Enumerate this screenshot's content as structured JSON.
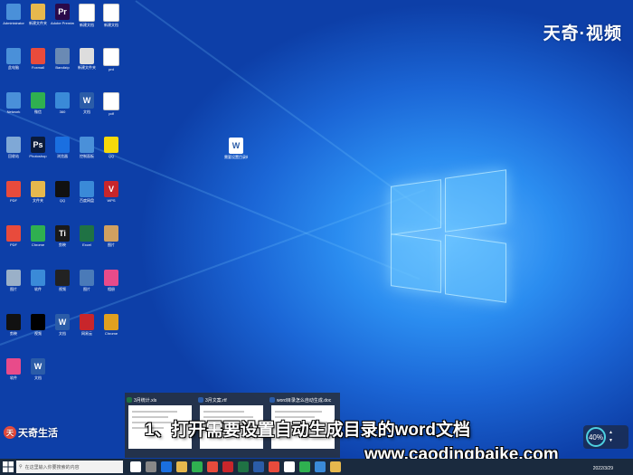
{
  "watermark": {
    "brand_top": "天奇·视频",
    "brand_bottom": "天奇生活"
  },
  "desktop_icons": [
    {
      "label": "Administrator",
      "color": "#4a90d9",
      "glyph": ""
    },
    {
      "label": "新建文件夹",
      "color": "#e6b84d",
      "glyph": ""
    },
    {
      "label": "Adobe Premiere",
      "color": "#2a0a4a",
      "glyph": "Pr"
    },
    {
      "label": "新建文档",
      "color": "#ffffff",
      "glyph": ""
    },
    {
      "label": "新建文档",
      "color": "#ffffff",
      "glyph": ""
    },
    {
      "label": "此电脑",
      "color": "#4a90d9",
      "glyph": ""
    },
    {
      "label": "Foxmail",
      "color": "#e84b3c",
      "glyph": ""
    },
    {
      "label": "Bandizip",
      "color": "#6a8ab4",
      "glyph": ""
    },
    {
      "label": "新建文件夹",
      "color": "#dddddd",
      "glyph": ""
    },
    {
      "label": "prd",
      "color": "#ffffff",
      "glyph": ""
    },
    {
      "label": "Network",
      "color": "#4a90d9",
      "glyph": ""
    },
    {
      "label": "微信",
      "color": "#2fb050",
      "glyph": ""
    },
    {
      "label": "360",
      "color": "#3a8ad8",
      "glyph": ""
    },
    {
      "label": "文档",
      "color": "#2b5ca8",
      "glyph": "W"
    },
    {
      "label": "pdf",
      "color": "#ffffff",
      "glyph": ""
    },
    {
      "label": "回收站",
      "color": "#7fa8d6",
      "glyph": ""
    },
    {
      "label": "Photoshop",
      "color": "#0a1a3a",
      "glyph": "Ps"
    },
    {
      "label": "浏览器",
      "color": "#1a6fe0",
      "glyph": ""
    },
    {
      "label": "控制面板",
      "color": "#4a90d9",
      "glyph": ""
    },
    {
      "label": "QQ",
      "color": "#f5d90a",
      "glyph": ""
    },
    {
      "label": "PDF",
      "color": "#e84b3c",
      "glyph": ""
    },
    {
      "label": "文件夹",
      "color": "#e6b84d",
      "glyph": ""
    },
    {
      "label": "QQ",
      "color": "#111111",
      "glyph": ""
    },
    {
      "label": "百度网盘",
      "color": "#3a8ad8",
      "glyph": ""
    },
    {
      "label": "WPS",
      "color": "#c8262b",
      "glyph": "V"
    },
    {
      "label": "PDF",
      "color": "#e84b3c",
      "glyph": ""
    },
    {
      "label": "Chrome",
      "color": "#2fb050",
      "glyph": ""
    },
    {
      "label": "剪映",
      "color": "#1a1a1a",
      "glyph": "Ti"
    },
    {
      "label": "Excel",
      "color": "#1f7244",
      "glyph": ""
    },
    {
      "label": "图片",
      "color": "#d0a060",
      "glyph": ""
    },
    {
      "label": "图片",
      "color": "#9ab0c8",
      "glyph": ""
    },
    {
      "label": "软件",
      "color": "#3a8ad8",
      "glyph": ""
    },
    {
      "label": "视频",
      "color": "#222222",
      "glyph": ""
    },
    {
      "label": "图片",
      "color": "#4a7ab8",
      "glyph": ""
    },
    {
      "label": "相册",
      "color": "#e84b8a",
      "glyph": ""
    },
    {
      "label": "剪映",
      "color": "#111111",
      "glyph": ""
    },
    {
      "label": "视频",
      "color": "#000000",
      "glyph": ""
    },
    {
      "label": "文档",
      "color": "#2b5ca8",
      "glyph": "W"
    },
    {
      "label": "网易云",
      "color": "#c8262b",
      "glyph": ""
    },
    {
      "label": "Chrome",
      "color": "#e0a020",
      "glyph": ""
    },
    {
      "label": "软件",
      "color": "#e84b8a",
      "glyph": ""
    },
    {
      "label": "文档",
      "color": "#2b5ca8",
      "glyph": "W"
    }
  ],
  "center_icon": {
    "label": "需要设置目录的文档"
  },
  "previews": [
    {
      "title": "3月统计.xls",
      "color": "#1f7244"
    },
    {
      "title": "3月文案.rtf",
      "color": "#2b5ca8"
    },
    {
      "title": "word目录怎么自动生成.doc",
      "color": "#2b5ca8"
    }
  ],
  "subtitle": "1、打开需要设置自动生成目录的word文档",
  "url": "www.caodingbaike.com",
  "taskbar": {
    "search_placeholder": "在这里输入你要搜索的内容",
    "tray_text": "2022/3/29",
    "icon_colors": [
      "#ffffff",
      "#888888",
      "#1a6fe0",
      "#e6b84d",
      "#2fb050",
      "#e84b3c",
      "#c8262b",
      "#1f7244",
      "#2b5ca8",
      "#e84b3c",
      "#ffffff",
      "#2fb050",
      "#3a8ad8",
      "#e6b84d"
    ]
  },
  "gauge": {
    "value": "40",
    "unit": "%"
  }
}
